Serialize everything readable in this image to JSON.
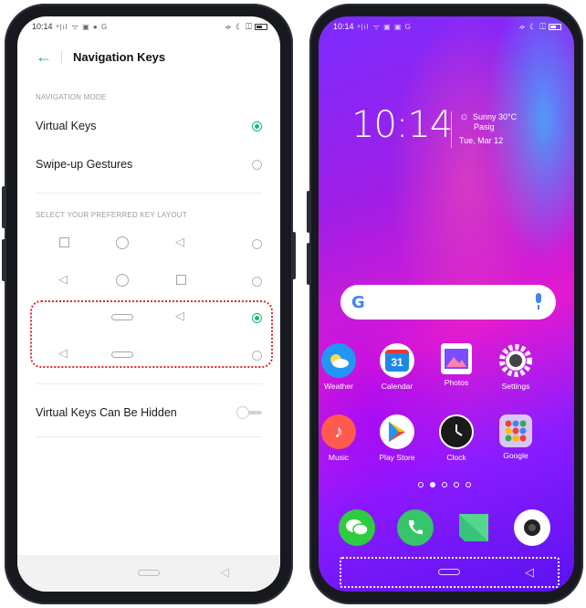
{
  "settings_screen": {
    "status": {
      "time": "10:14",
      "signal": "ᵃ|ıl",
      "left_icons": "ᯤ ▣ ● G",
      "right_icons": "ᨀ ☾ ◫"
    },
    "header": {
      "title": "Navigation Keys"
    },
    "navigation_mode": {
      "section_label": "NAVIGATION MODE",
      "options": [
        {
          "label": "Virtual Keys",
          "selected": true
        },
        {
          "label": "Swipe-up Gestures",
          "selected": false
        }
      ]
    },
    "key_layout": {
      "section_label": "SELECT YOUR PREFERRED KEY LAYOUT",
      "layouts": [
        {
          "keys": [
            "square",
            "circle",
            "triangle"
          ],
          "selected": false
        },
        {
          "keys": [
            "triangle",
            "circle",
            "square"
          ],
          "selected": false
        },
        {
          "keys": [
            "",
            "pill",
            "triangle"
          ],
          "selected": true
        },
        {
          "keys": [
            "triangle",
            "pill",
            ""
          ],
          "selected": false
        }
      ]
    },
    "toggle": {
      "label": "Virtual Keys Can Be Hidden",
      "enabled": false
    }
  },
  "home_screen": {
    "status": {
      "time": "10:14",
      "signal": "ᵃ|ıl",
      "left_icons": "ᯤ ▣ ▣ G",
      "right_icons": "ᨀ ☾ ◫"
    },
    "clock": "10:14",
    "weather": {
      "condition": "Sunny 30°C",
      "location": "Pasig",
      "date": "Tue, Mar 12"
    },
    "search": {
      "logo": "G"
    },
    "apps_row1": [
      {
        "label": "Weather",
        "icon": "weather-icon",
        "color": "#1e88e5"
      },
      {
        "label": "Calendar",
        "icon": "calendar-icon",
        "color": "#ffffff"
      },
      {
        "label": "Photos",
        "icon": "photos-icon",
        "color": "#ffffff"
      },
      {
        "label": "Settings",
        "icon": "settings-icon",
        "color": "#ffffff"
      }
    ],
    "apps_row2": [
      {
        "label": "Music",
        "icon": "music-icon",
        "color": "#ff5a4f"
      },
      {
        "label": "Play Store",
        "icon": "play-store-icon",
        "color": "#ffffff"
      },
      {
        "label": "Clock",
        "icon": "clock-icon",
        "color": "#1a1a1a"
      },
      {
        "label": "Google",
        "icon": "google-folder-icon",
        "color": "#d8c7f5"
      }
    ],
    "calendar_day": "31",
    "page_dots": 5,
    "active_dot": 1,
    "dock": [
      {
        "icon": "messages-icon",
        "color": "#2ecc40"
      },
      {
        "icon": "phone-icon",
        "color": "#36c56a"
      },
      {
        "icon": "sms-icon",
        "color": "#39c27b"
      },
      {
        "icon": "camera-icon",
        "color": "#ffffff"
      }
    ]
  },
  "colors": {
    "accent": "#1cb86f",
    "highlight": "#e0262b"
  }
}
